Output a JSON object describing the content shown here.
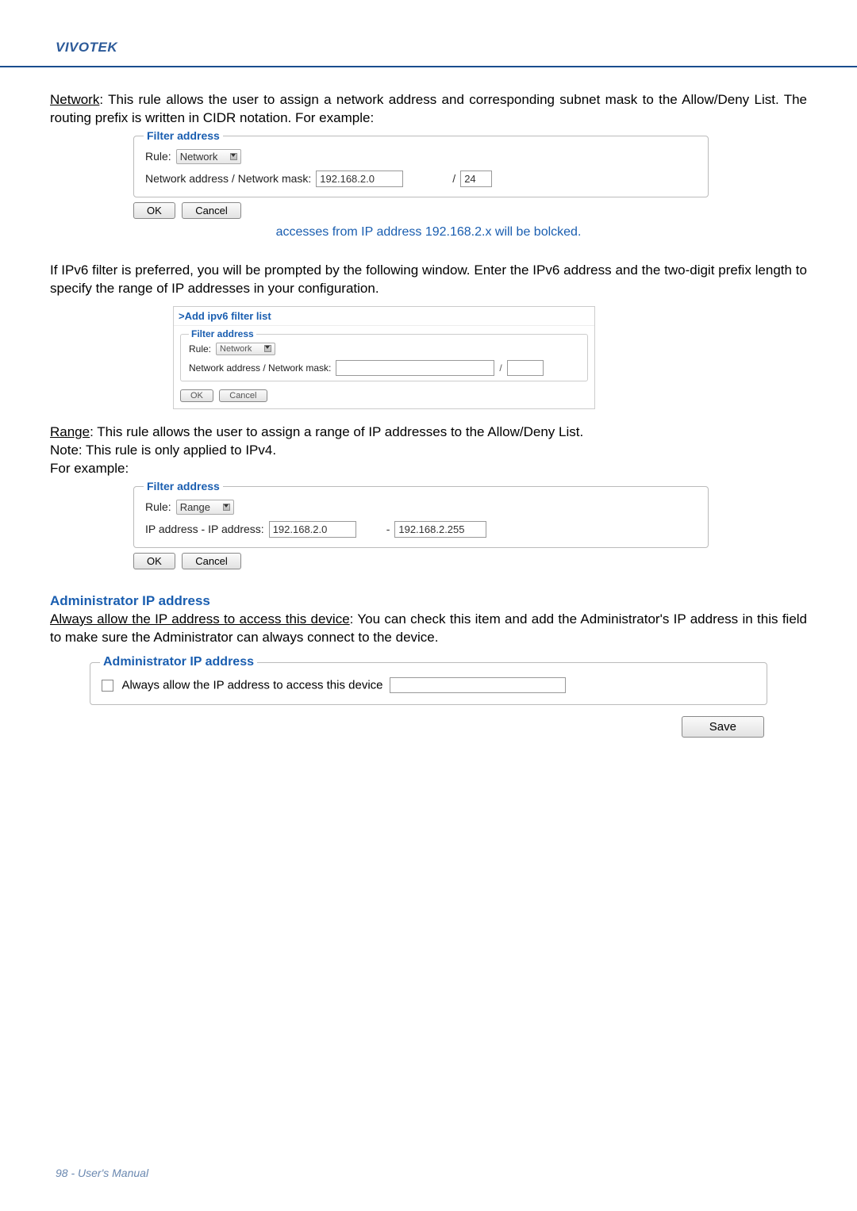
{
  "brand": "VIVOTEK",
  "para1_prefix": "Network",
  "para1_rest": ": This rule allows the user to assign a network address and corresponding subnet mask to the Allow/Deny List. The routing prefix is written in CIDR notation. For example:",
  "panel1": {
    "legend": "Filter address",
    "rule_label": "Rule:",
    "rule_value": "Network",
    "addr_label": "Network address / Network mask:",
    "addr_value": "192.168.2.0",
    "slash": "/",
    "mask_value": "24"
  },
  "ok_label": "OK",
  "cancel_label": "Cancel",
  "caption1": "accesses from IP address 192.168.2.x will be bolcked.",
  "para2": "If IPv6 filter is preferred, you will be prompted by the following window. Enter the IPv6 address and the two-digit prefix length to specify the range of IP addresses in your configuration.",
  "ipv6": {
    "title": ">Add ipv6 filter list",
    "legend": "Filter address",
    "rule_label": "Rule:",
    "rule_value": "Network",
    "addr_label": "Network address / Network mask:",
    "slash": "/"
  },
  "para3_prefix": "Range",
  "para3_rest": ": This rule allows the user to assign a range of IP addresses to the Allow/Deny List.",
  "para3_note": "Note: This rule is only applied to IPv4.",
  "para3_ex": "For example:",
  "panel3": {
    "legend": "Filter address",
    "rule_label": "Rule:",
    "rule_value": "Range",
    "addr_label": "IP address - IP address:",
    "from_value": "192.168.2.0",
    "dash": "-",
    "to_value": "192.168.2.255"
  },
  "admin": {
    "heading": "Administrator IP address",
    "para_prefix": "Always allow the IP address to access this device",
    "para_rest": ": You can check this item and add the Administrator's IP address in this field to make sure the Administrator can always connect to the device.",
    "legend": "Administrator IP address",
    "chk_label": "Always allow the IP address to access this device"
  },
  "save_label": "Save",
  "footer": "98 - User's Manual"
}
